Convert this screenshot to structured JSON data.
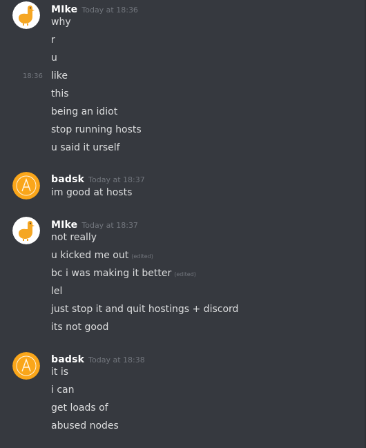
{
  "groups": [
    {
      "author": "MIke",
      "timestamp": "Today at 18:36",
      "avatar": "goose-icon",
      "hover_time": "18:36",
      "messages": [
        {
          "text": "why"
        },
        {
          "text": "r"
        },
        {
          "text": "u"
        },
        {
          "text": "like"
        },
        {
          "text": "this"
        },
        {
          "text": "being an idiot"
        },
        {
          "text": "stop running hosts"
        },
        {
          "text": "u said it urself"
        }
      ]
    },
    {
      "author": "badsk",
      "timestamp": "Today at 18:37",
      "avatar": "badsk-logo-icon",
      "messages": [
        {
          "text": "im good at hosts"
        }
      ]
    },
    {
      "author": "MIke",
      "timestamp": "Today at 18:37",
      "avatar": "goose-icon",
      "messages": [
        {
          "text": "not really"
        },
        {
          "text": "u kicked me out",
          "edited": "(edited)"
        },
        {
          "text": "bc i was making it better",
          "edited": "(edited)"
        },
        {
          "text": "lel"
        },
        {
          "text": "just stop it and quit hostings + discord"
        },
        {
          "text": "its not good"
        }
      ]
    },
    {
      "author": "badsk",
      "timestamp": "Today at 18:38",
      "avatar": "badsk-logo-icon",
      "messages": [
        {
          "text": "it is"
        },
        {
          "text": "i can"
        },
        {
          "text": "get loads of"
        },
        {
          "text": "abused nodes"
        }
      ]
    }
  ],
  "colors": {
    "background": "#36393f",
    "username": "#ffffff",
    "message_text": "#dcddde",
    "timestamp": "#72767d",
    "goose_avatar_bg": "#ffffff",
    "goose_body": "#f5a623",
    "badsk_avatar_bg": "#faa61a"
  }
}
